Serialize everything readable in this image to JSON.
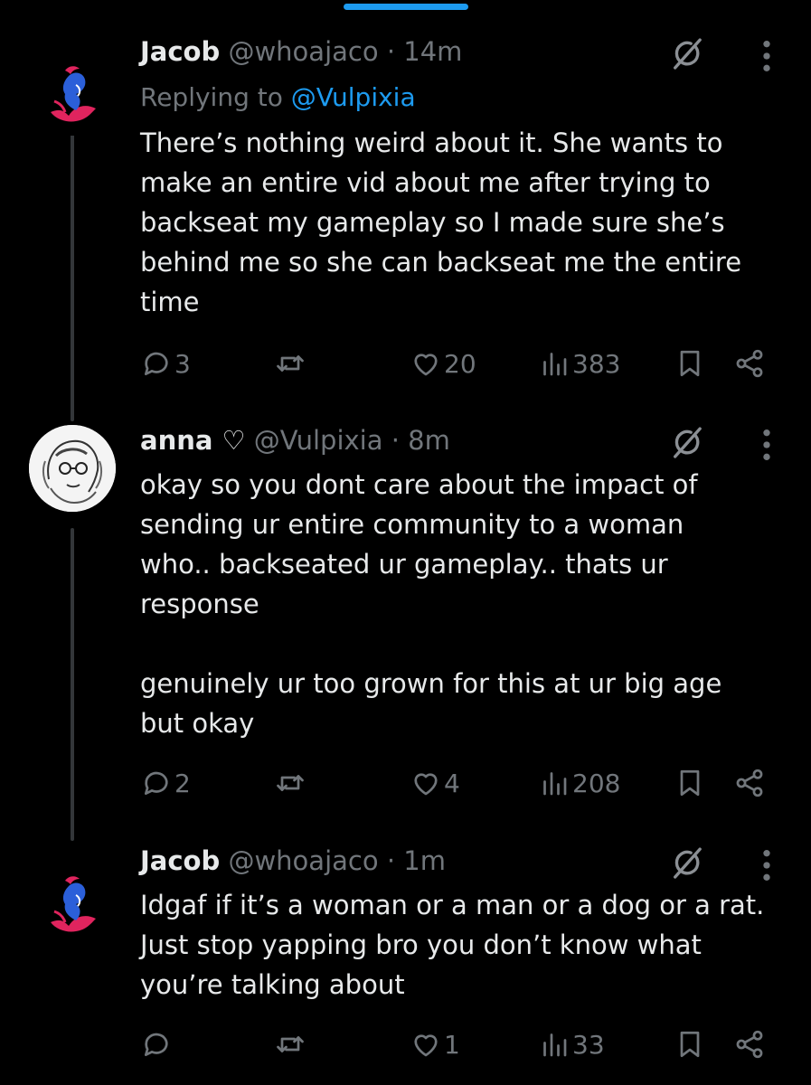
{
  "tweets": [
    {
      "name": "Jacob",
      "handle": "@whoajaco",
      "dot": "·",
      "time": "14m",
      "replying_prefix": "Replying to",
      "replying_to": "@Vulpixia",
      "text": "There’s nothing weird about it. She wants to\nmake an entire vid about me after trying to\nbackseat my gameplay so I made sure she’s\nbehind me so she can backseat me the entire\ntime",
      "replies": "3",
      "likes": "20",
      "views": "383"
    },
    {
      "name": "anna ♡",
      "handle": "@Vulpixia",
      "dot": "·",
      "time": "8m",
      "text": "okay so you dont care about the impact of\nsending ur entire community to a woman\nwho.. backseated ur gameplay.. thats ur\nresponse\n\ngenuinely ur too grown for this at ur big age\nbut okay",
      "replies": "2",
      "likes": "4",
      "views": "208"
    },
    {
      "name": "Jacob",
      "handle": "@whoajaco",
      "dot": "·",
      "time": "1m",
      "text": "Idgaf if it’s a woman or a man or a dog or a rat.\nJust stop yapping bro you don’t know what\nyou’re talking about",
      "replies": "",
      "likes": "1",
      "views": "33"
    }
  ],
  "icons": {
    "reply": "reply-icon",
    "retweet": "retweet-icon",
    "like": "heart-icon",
    "views": "views-icon",
    "bookmark": "bookmark-icon",
    "share": "share-icon",
    "grok": "grok-icon",
    "more": "more-icon"
  },
  "colors": {
    "background": "#000000",
    "text": "#e7e9ea",
    "muted": "#71767b",
    "accent": "#1d9bf0"
  }
}
